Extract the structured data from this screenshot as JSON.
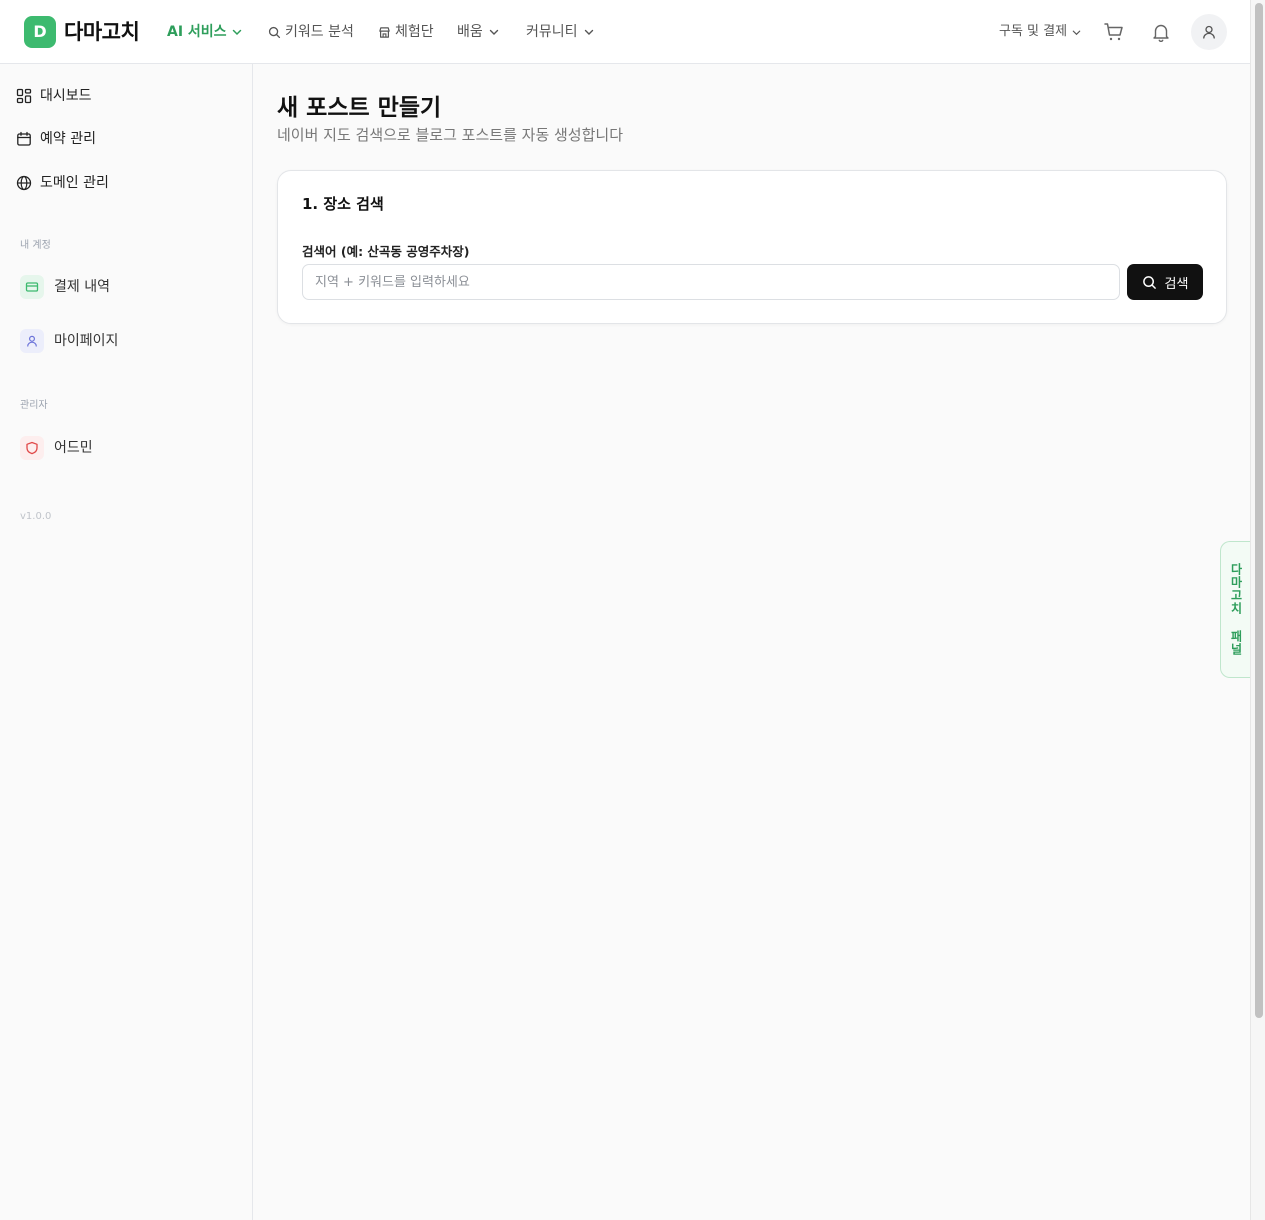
{
  "header": {
    "logo_letter": "D",
    "logo_text": "다마고치",
    "nav": [
      {
        "label": "AI 서비스",
        "active": true
      },
      {
        "label": "키워드 분석"
      },
      {
        "label": "체험단"
      },
      {
        "label": "배움"
      },
      {
        "label": "커뮤니티"
      }
    ],
    "subscribe_label": "구독 및 결제"
  },
  "sidebar": {
    "items": [
      {
        "label": "대시보드",
        "icon": "dashboard-icon"
      },
      {
        "label": "예약 관리",
        "icon": "calendar-icon"
      },
      {
        "label": "도메인 관리",
        "icon": "globe-icon"
      }
    ],
    "account_section": "내 계정",
    "account_items": [
      {
        "label": "결제 내역",
        "icon": "card-icon"
      },
      {
        "label": "마이페이지",
        "icon": "user-icon"
      }
    ],
    "admin_section": "관리자",
    "admin_items": [
      {
        "label": "어드민",
        "icon": "shield-icon"
      }
    ],
    "version": "v1.0.0"
  },
  "main": {
    "title": "새 포스트 만들기",
    "subtitle": "네이버 지도 검색으로 블로그 포스트를 자동 생성합니다",
    "card": {
      "title": "1. 장소 검색",
      "field_label": "검색어 (예: 산곡동 공영주차장)",
      "placeholder": "지역 + 키워드를 입력하세요",
      "value": "",
      "button_label": "검색"
    }
  },
  "float_panel": {
    "label": "다마고치 패널"
  },
  "colors": {
    "brand": "#3dba6f",
    "brand_text": "#2e9e5b",
    "button_dark": "#111111"
  }
}
